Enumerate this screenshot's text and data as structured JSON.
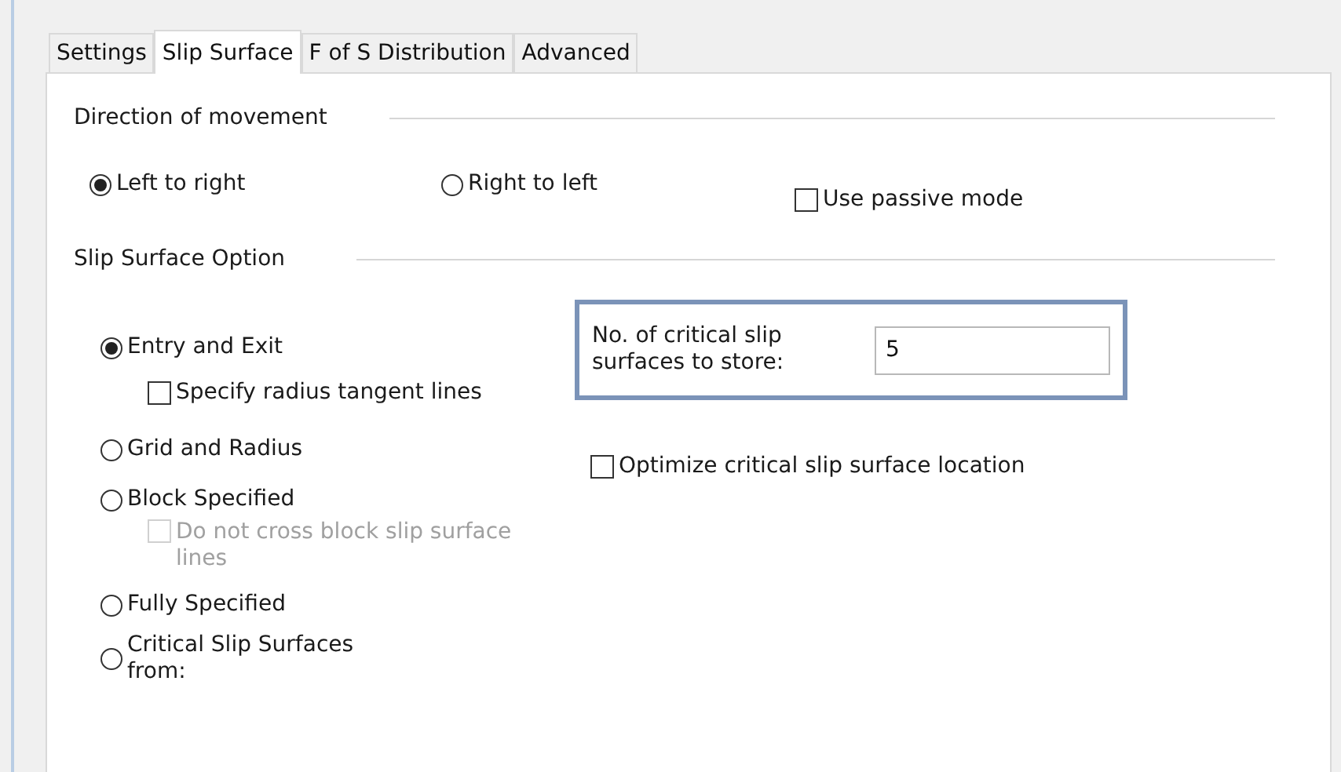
{
  "tabs": [
    {
      "label": "Settings",
      "selected": false
    },
    {
      "label": "Slip Surface",
      "selected": true
    },
    {
      "label": "F of S Distribution",
      "selected": false
    },
    {
      "label": "Advanced",
      "selected": false
    }
  ],
  "direction": {
    "heading": "Direction of movement",
    "options": [
      {
        "label": "Left to right",
        "selected": true
      },
      {
        "label": "Right to left",
        "selected": false
      }
    ],
    "passive_mode": {
      "label": "Use passive mode",
      "checked": false
    }
  },
  "slip_surface_option": {
    "heading": "Slip Surface Option",
    "options": [
      {
        "label": "Entry and Exit",
        "selected": true,
        "suboption": {
          "label": "Specify radius tangent lines",
          "checked": false,
          "disabled": false
        }
      },
      {
        "label": "Grid and Radius",
        "selected": false
      },
      {
        "label": "Block Specified",
        "selected": false,
        "suboption": {
          "label": "Do not cross block slip surface lines",
          "checked": false,
          "disabled": true
        }
      },
      {
        "label": "Fully Specified",
        "selected": false
      },
      {
        "label": "Critical Slip Surfaces from:",
        "selected": false
      }
    ],
    "critical_count": {
      "label": "No. of critical slip surfaces to store:",
      "value": "5"
    },
    "optimize": {
      "label": "Optimize critical slip surface location",
      "checked": false
    }
  }
}
